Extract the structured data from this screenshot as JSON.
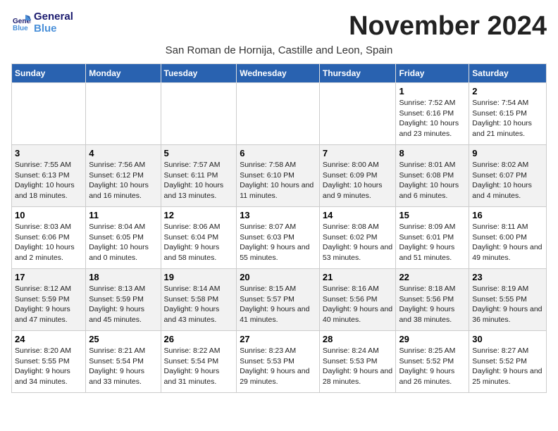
{
  "logo": {
    "line1": "General",
    "line2": "Blue"
  },
  "title": "November 2024",
  "subtitle": "San Roman de Hornija, Castille and Leon, Spain",
  "headers": [
    "Sunday",
    "Monday",
    "Tuesday",
    "Wednesday",
    "Thursday",
    "Friday",
    "Saturday"
  ],
  "weeks": [
    [
      {
        "day": "",
        "content": ""
      },
      {
        "day": "",
        "content": ""
      },
      {
        "day": "",
        "content": ""
      },
      {
        "day": "",
        "content": ""
      },
      {
        "day": "",
        "content": ""
      },
      {
        "day": "1",
        "content": "Sunrise: 7:52 AM\nSunset: 6:16 PM\nDaylight: 10 hours and 23 minutes."
      },
      {
        "day": "2",
        "content": "Sunrise: 7:54 AM\nSunset: 6:15 PM\nDaylight: 10 hours and 21 minutes."
      }
    ],
    [
      {
        "day": "3",
        "content": "Sunrise: 7:55 AM\nSunset: 6:13 PM\nDaylight: 10 hours and 18 minutes."
      },
      {
        "day": "4",
        "content": "Sunrise: 7:56 AM\nSunset: 6:12 PM\nDaylight: 10 hours and 16 minutes."
      },
      {
        "day": "5",
        "content": "Sunrise: 7:57 AM\nSunset: 6:11 PM\nDaylight: 10 hours and 13 minutes."
      },
      {
        "day": "6",
        "content": "Sunrise: 7:58 AM\nSunset: 6:10 PM\nDaylight: 10 hours and 11 minutes."
      },
      {
        "day": "7",
        "content": "Sunrise: 8:00 AM\nSunset: 6:09 PM\nDaylight: 10 hours and 9 minutes."
      },
      {
        "day": "8",
        "content": "Sunrise: 8:01 AM\nSunset: 6:08 PM\nDaylight: 10 hours and 6 minutes."
      },
      {
        "day": "9",
        "content": "Sunrise: 8:02 AM\nSunset: 6:07 PM\nDaylight: 10 hours and 4 minutes."
      }
    ],
    [
      {
        "day": "10",
        "content": "Sunrise: 8:03 AM\nSunset: 6:06 PM\nDaylight: 10 hours and 2 minutes."
      },
      {
        "day": "11",
        "content": "Sunrise: 8:04 AM\nSunset: 6:05 PM\nDaylight: 10 hours and 0 minutes."
      },
      {
        "day": "12",
        "content": "Sunrise: 8:06 AM\nSunset: 6:04 PM\nDaylight: 9 hours and 58 minutes."
      },
      {
        "day": "13",
        "content": "Sunrise: 8:07 AM\nSunset: 6:03 PM\nDaylight: 9 hours and 55 minutes."
      },
      {
        "day": "14",
        "content": "Sunrise: 8:08 AM\nSunset: 6:02 PM\nDaylight: 9 hours and 53 minutes."
      },
      {
        "day": "15",
        "content": "Sunrise: 8:09 AM\nSunset: 6:01 PM\nDaylight: 9 hours and 51 minutes."
      },
      {
        "day": "16",
        "content": "Sunrise: 8:11 AM\nSunset: 6:00 PM\nDaylight: 9 hours and 49 minutes."
      }
    ],
    [
      {
        "day": "17",
        "content": "Sunrise: 8:12 AM\nSunset: 5:59 PM\nDaylight: 9 hours and 47 minutes."
      },
      {
        "day": "18",
        "content": "Sunrise: 8:13 AM\nSunset: 5:59 PM\nDaylight: 9 hours and 45 minutes."
      },
      {
        "day": "19",
        "content": "Sunrise: 8:14 AM\nSunset: 5:58 PM\nDaylight: 9 hours and 43 minutes."
      },
      {
        "day": "20",
        "content": "Sunrise: 8:15 AM\nSunset: 5:57 PM\nDaylight: 9 hours and 41 minutes."
      },
      {
        "day": "21",
        "content": "Sunrise: 8:16 AM\nSunset: 5:56 PM\nDaylight: 9 hours and 40 minutes."
      },
      {
        "day": "22",
        "content": "Sunrise: 8:18 AM\nSunset: 5:56 PM\nDaylight: 9 hours and 38 minutes."
      },
      {
        "day": "23",
        "content": "Sunrise: 8:19 AM\nSunset: 5:55 PM\nDaylight: 9 hours and 36 minutes."
      }
    ],
    [
      {
        "day": "24",
        "content": "Sunrise: 8:20 AM\nSunset: 5:55 PM\nDaylight: 9 hours and 34 minutes."
      },
      {
        "day": "25",
        "content": "Sunrise: 8:21 AM\nSunset: 5:54 PM\nDaylight: 9 hours and 33 minutes."
      },
      {
        "day": "26",
        "content": "Sunrise: 8:22 AM\nSunset: 5:54 PM\nDaylight: 9 hours and 31 minutes."
      },
      {
        "day": "27",
        "content": "Sunrise: 8:23 AM\nSunset: 5:53 PM\nDaylight: 9 hours and 29 minutes."
      },
      {
        "day": "28",
        "content": "Sunrise: 8:24 AM\nSunset: 5:53 PM\nDaylight: 9 hours and 28 minutes."
      },
      {
        "day": "29",
        "content": "Sunrise: 8:25 AM\nSunset: 5:52 PM\nDaylight: 9 hours and 26 minutes."
      },
      {
        "day": "30",
        "content": "Sunrise: 8:27 AM\nSunset: 5:52 PM\nDaylight: 9 hours and 25 minutes."
      }
    ]
  ]
}
